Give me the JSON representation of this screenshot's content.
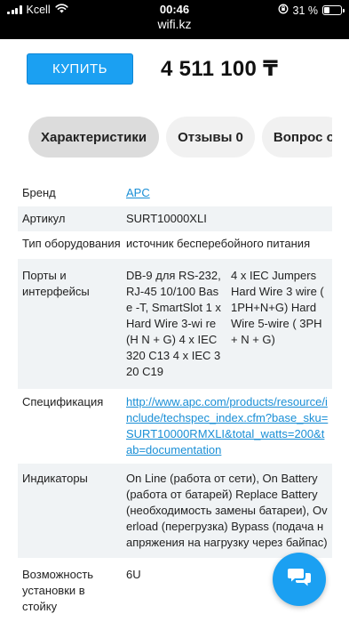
{
  "status_bar": {
    "carrier": "Kcell",
    "time": "00:46",
    "url": "wifi.kz",
    "battery": "31 %",
    "battery_level": 0.31
  },
  "buy": {
    "button_label": "КУПИТЬ",
    "price": "4 511 100 ₸"
  },
  "tabs": [
    {
      "label": "Характеристики",
      "active": true
    },
    {
      "label": "Отзывы 0",
      "active": false
    },
    {
      "label": "Вопрос о",
      "active": false
    }
  ],
  "specs": {
    "brand": {
      "label": "Бренд",
      "value": "APC"
    },
    "article": {
      "label": "Артикул",
      "value": "SURT10000XLI"
    },
    "type": {
      "label": "Тип оборудования",
      "value": "источник бесперебойного питания"
    },
    "ports": {
      "label": "Порты и интерфейсы",
      "col1": "DB-9 для RS-232, RJ-45 10/100 Base -T, SmartSlot 1 x Hard Wire 3-wi re (H N + G) 4 x IEC 320 C13 4 x IEC 320 C19",
      "col2": "4 x IEC Jumpers Hard Wire 3 wire ( 1PH+N+G) Hard Wire 5-wire ( 3PH + N + G)"
    },
    "specification": {
      "label": "Спецификация",
      "value": "http://www.apc.com/products/resource/include/techspec_index.cfm?base_sku=SURT10000RMXLI&total_watts=200&tab=documentation"
    },
    "indicators": {
      "label": "Индикаторы",
      "value": "On Line (работа от сети), On Battery (работа от батарей) Replace Battery (необходимость замены батареи), Overload (перегрузка) Bypass (подача напряжения на нагрузку через байпас)"
    },
    "rack": {
      "label": "Возможность установки в стойку",
      "value": "6U"
    }
  },
  "icons": {
    "chat": "chat-bubbles-icon",
    "wifi": "wifi-icon",
    "signal": "cellular-signal-icon",
    "lock": "orientation-lock-icon",
    "battery": "battery-icon"
  },
  "colors": {
    "accent": "#1ba0f2",
    "link": "#1a8fd6",
    "row_alt": "#f0f3f5"
  }
}
